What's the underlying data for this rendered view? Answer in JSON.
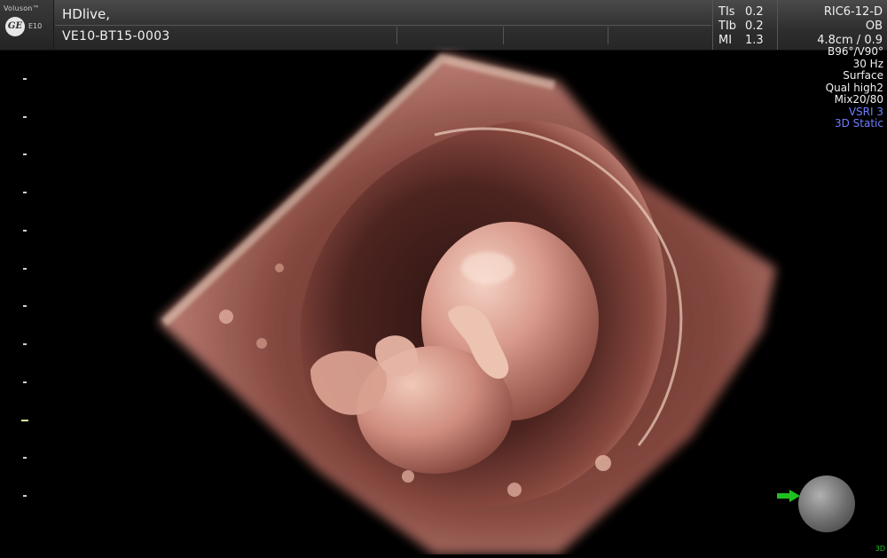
{
  "brand": {
    "product": "Voluson™",
    "logo_text": "GE",
    "model": "E10"
  },
  "header": {
    "mode_title": "HDlive,",
    "patient_id": "VE10-BT15-0003"
  },
  "indices": [
    {
      "label": "TIs",
      "value": "0.2"
    },
    {
      "label": "TIb",
      "value": "0.2"
    },
    {
      "label": "MI",
      "value": "1.3"
    }
  ],
  "probe": {
    "name": "RIC6-12-D",
    "application": "OB",
    "depth": "4.8cm / 0.9"
  },
  "params": [
    {
      "text": "B96°/V90°",
      "accent": false
    },
    {
      "text": "30 Hz",
      "accent": false
    },
    {
      "text": "Surface",
      "accent": false
    },
    {
      "text": "Qual high2",
      "accent": false
    },
    {
      "text": "Mix20/80",
      "accent": false
    },
    {
      "text": "VSRI 3",
      "accent": true
    },
    {
      "text": "3D Static",
      "accent": true
    }
  ],
  "depth_scale": {
    "markers": 12,
    "focus_index": 9
  },
  "orientation": {
    "corner_mark": "3D"
  },
  "colors": {
    "accent_blue": "#6f7dff",
    "orientation_green": "#20c020",
    "tissue": "#c98a82"
  }
}
